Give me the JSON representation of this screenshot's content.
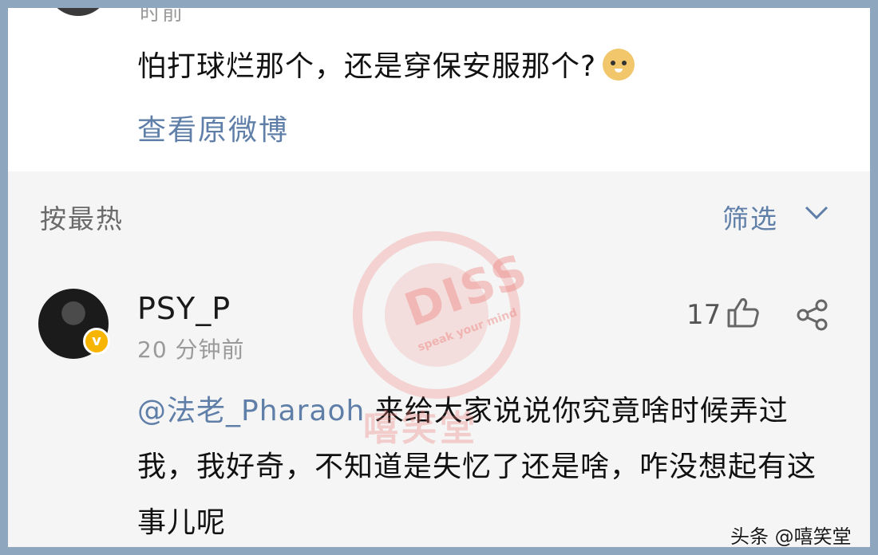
{
  "post": {
    "prev_time": "时前",
    "text": "怕打球烂那个，还是穿保安服那个?",
    "view_original": "查看原微博"
  },
  "comments_header": {
    "sort_label": "按最热",
    "filter_label": "筛选"
  },
  "comment": {
    "username": "PSY_P",
    "time": "20 分钟前",
    "likes": "17",
    "mention": "@法老_Pharaoh",
    "body": " 来给大家说说你究竟啥时候弄过我，我好奇，不知道是失忆了还是啥，咋没想起有这事儿呢"
  },
  "watermark": {
    "stamp_main": "DISS",
    "stamp_sub": "speak your mind",
    "overlay": "嘻笑堂"
  },
  "source_mark": "头条 @嘻笑堂",
  "colors": {
    "link": "#5f7fa8",
    "verified": "#f7b500",
    "border": "#8fa6bf"
  },
  "icons": [
    "doge-emoji-icon",
    "chevron-down-icon",
    "thumb-up-icon",
    "share-icon"
  ]
}
